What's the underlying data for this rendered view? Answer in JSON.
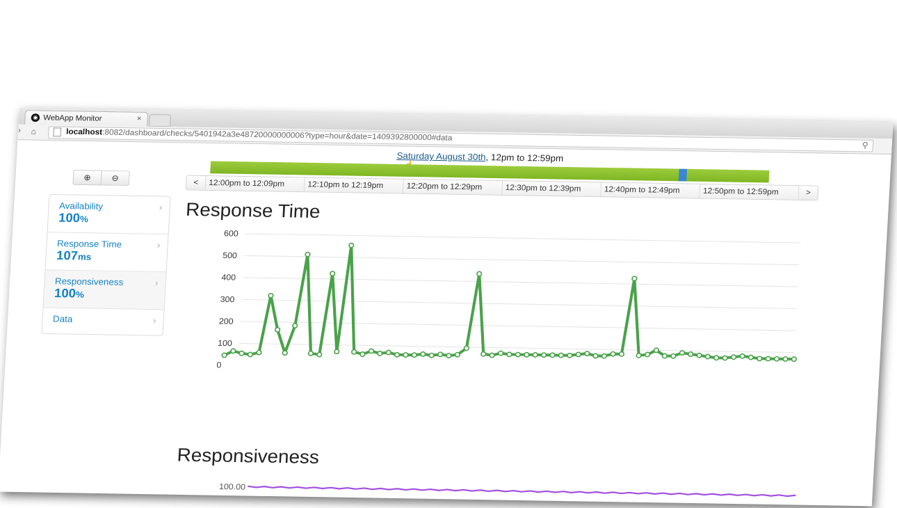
{
  "browser": {
    "tab_title": "WebApp Monitor",
    "tab_close": "×",
    "url_host": "localhost",
    "url_rest": ":8082/dashboard/checks/5401942a3e48720000000006?type=hour&date=1409392800000#data",
    "zoom_icon": "magnifier-icon"
  },
  "header": {
    "date_link": "Saturday August 30th",
    "date_range": ", 12pm to 12:59pm"
  },
  "timeline": {
    "selected_fraction": 0.845
  },
  "segments": {
    "prev": "<",
    "next": ">",
    "items": [
      "12:00pm to 12:09pm",
      "12:10pm to 12:19pm",
      "12:20pm to 12:29pm",
      "12:30pm to 12:39pm",
      "12:40pm to 12:49pm",
      "12:50pm to 12:59pm"
    ]
  },
  "sidebar": {
    "items": [
      {
        "label": "Availability",
        "value": "100",
        "unit": "%"
      },
      {
        "label": "Response Time",
        "value": "107",
        "unit": "ms"
      },
      {
        "label": "Responsiveness",
        "value": "100",
        "unit": "%"
      },
      {
        "label": "Data",
        "value": "",
        "unit": ""
      }
    ]
  },
  "sections": {
    "response_title": "Response Time",
    "responsiveness_title": "Responsiveness"
  },
  "colors": {
    "green": "#4aa24a",
    "purple": "#a24fe0",
    "link": "#1582c6",
    "bar_green": "#8cc230",
    "marker_blue": "#3a86d6"
  },
  "chart_data": [
    {
      "type": "line",
      "title": "Response Time",
      "xlabel": "",
      "ylabel": "",
      "y_ticks": [
        0,
        100,
        200,
        300,
        400,
        500,
        600
      ],
      "ylim": [
        0,
        600
      ],
      "grid": true,
      "x": [
        0,
        1,
        2,
        3,
        4,
        5,
        6,
        7,
        8,
        9,
        10,
        11,
        12,
        13,
        14,
        15,
        16,
        17,
        18,
        19,
        20,
        21,
        22,
        23,
        24,
        25,
        26,
        27,
        28,
        29,
        30,
        31,
        32,
        33,
        34,
        35,
        36,
        37,
        38,
        39,
        40,
        41,
        42,
        43,
        44,
        45,
        46,
        47,
        48,
        49,
        50,
        51,
        52,
        53,
        54,
        55,
        56,
        57,
        58,
        59,
        60,
        61,
        62,
        63,
        64,
        65,
        66
      ],
      "series": [
        {
          "values": [
            45,
            65,
            55,
            50,
            60,
            320,
            165,
            60,
            185,
            510,
            60,
            55,
            425,
            70,
            555,
            70,
            60,
            75,
            65,
            70,
            60,
            60,
            60,
            65,
            60,
            65,
            60,
            65,
            95,
            435,
            70,
            65,
            75,
            70,
            70,
            70,
            70,
            70,
            70,
            70,
            70,
            75,
            80,
            70,
            70,
            80,
            80,
            425,
            75,
            80,
            100,
            75,
            75,
            90,
            85,
            80,
            75,
            70,
            70,
            75,
            80,
            75,
            70,
            70,
            70,
            70,
            70
          ],
          "markers": true
        }
      ]
    },
    {
      "type": "line",
      "title": "Responsiveness",
      "y_ticks": [
        "100.00"
      ],
      "series": [
        {
          "values": [
            100,
            100,
            100,
            100,
            100,
            100,
            100,
            100,
            100,
            100,
            100,
            100,
            100,
            100,
            100,
            100,
            100,
            100,
            100,
            100,
            100,
            100,
            100,
            100,
            100,
            100,
            100,
            100,
            100,
            100,
            100,
            100,
            100,
            100,
            100,
            100,
            100,
            100,
            100,
            100,
            100,
            100,
            100,
            100,
            100,
            100,
            100,
            100,
            100,
            100,
            100,
            100,
            100,
            100,
            100,
            100,
            100,
            100,
            100,
            100,
            100,
            100,
            100,
            100,
            100,
            100,
            100
          ]
        }
      ]
    }
  ]
}
